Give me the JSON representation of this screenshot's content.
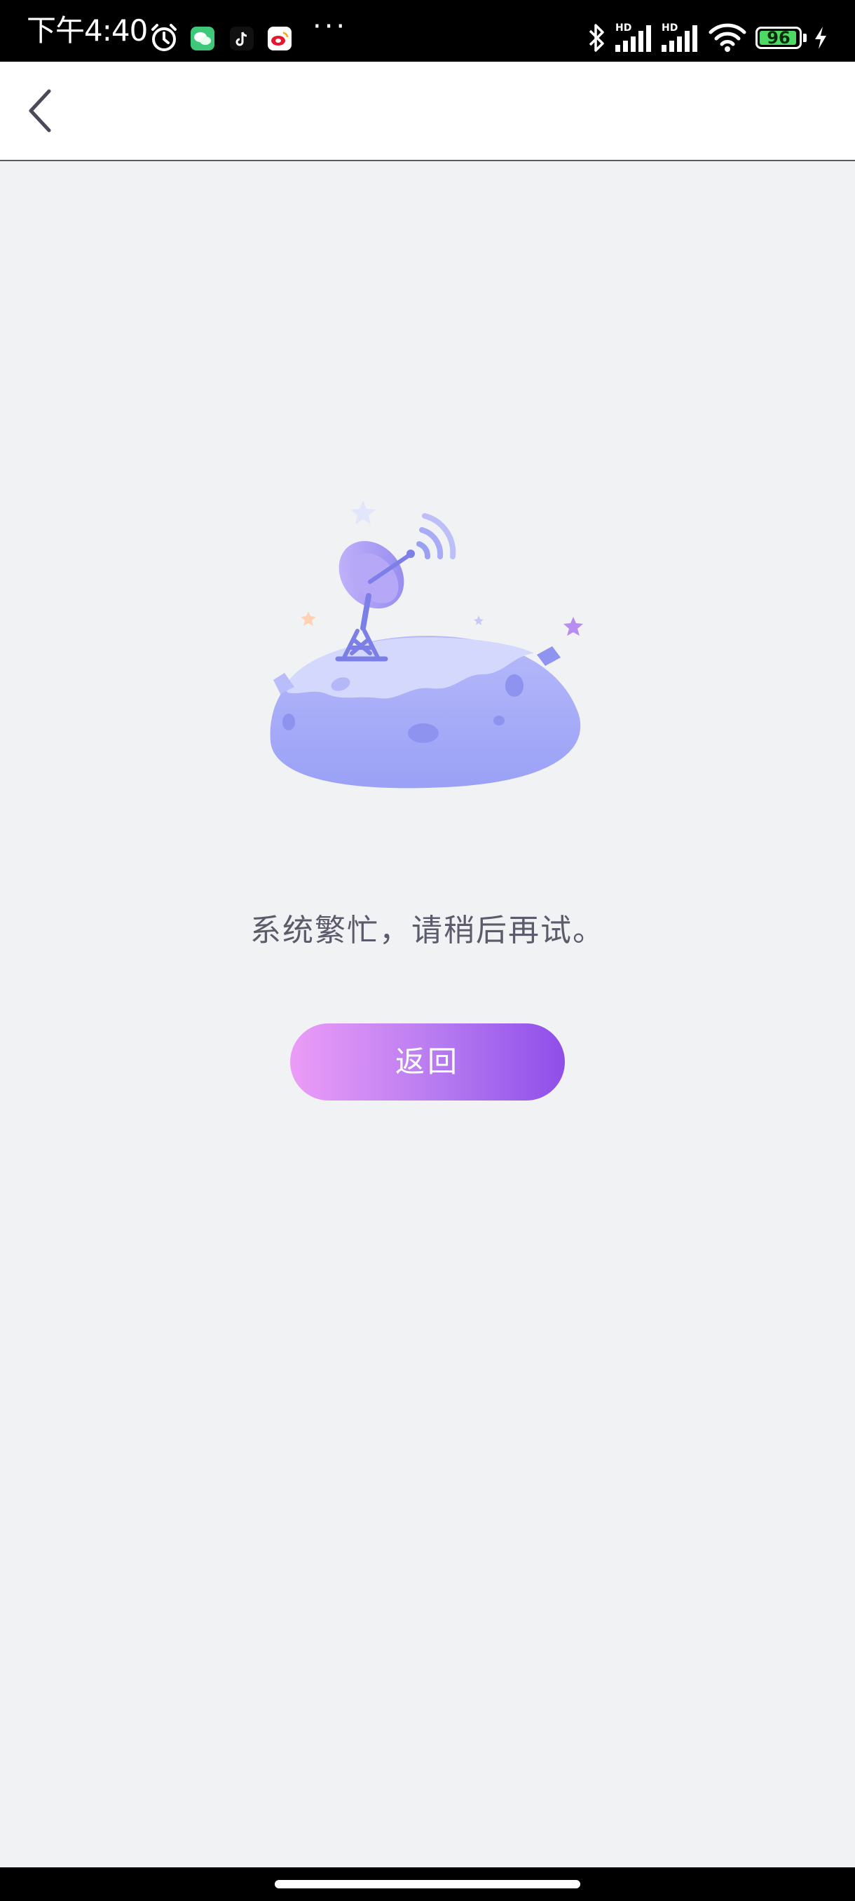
{
  "status_bar": {
    "time": "下午4:40",
    "battery_percent": "96",
    "battery_level": 0.96,
    "network_label_1": "HD",
    "network_label_2": "HD",
    "colors": {
      "background": "#000000",
      "battery_fill": "#4cd964"
    }
  },
  "header": {
    "back_icon": "chevron-left-icon"
  },
  "main": {
    "illustration_icon": "satellite-dish-planet-icon",
    "message": "系统繁忙，请稍后再试。",
    "return_button_label": "返回"
  },
  "colors": {
    "page_background": "#f1f2f4",
    "message_text": "#5c5a6b",
    "button_gradient_start": "#ec9cf7",
    "button_gradient_end": "#8f4eea"
  }
}
